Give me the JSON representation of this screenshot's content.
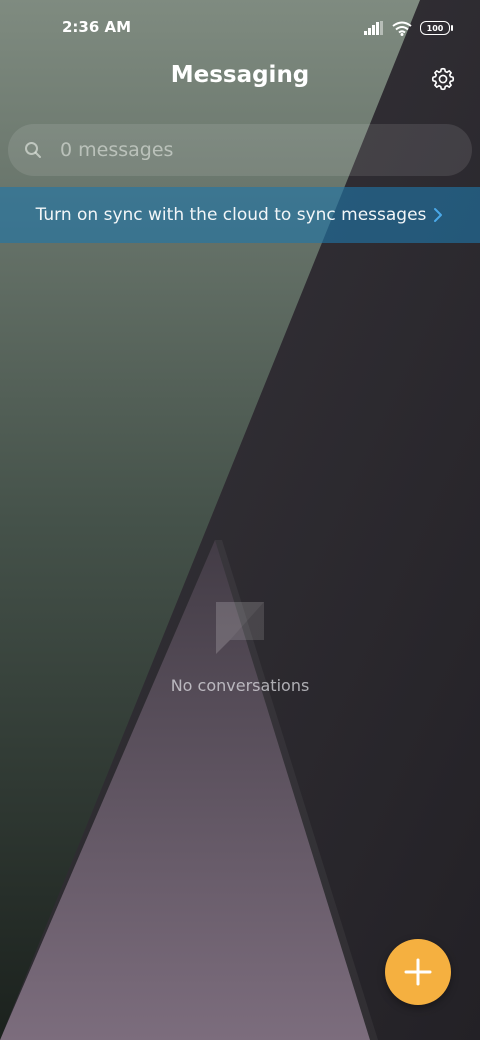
{
  "status_bar": {
    "time": "2:36 AM",
    "battery": "100",
    "icons": [
      "signal-icon",
      "wifi-icon",
      "battery-icon"
    ]
  },
  "header": {
    "title": "Messaging",
    "settings_icon": "gear-icon"
  },
  "search": {
    "placeholder": "0 messages",
    "icon": "search-icon"
  },
  "sync_banner": {
    "text": "Turn on sync with the cloud to sync messages",
    "chevron_icon": "chevron-right-icon",
    "chevron_color": "#4aa8e8"
  },
  "empty_state": {
    "icon": "chat-bubble-icon",
    "text": "No conversations"
  },
  "fab": {
    "icon": "plus-icon",
    "color": "#f5b040"
  }
}
